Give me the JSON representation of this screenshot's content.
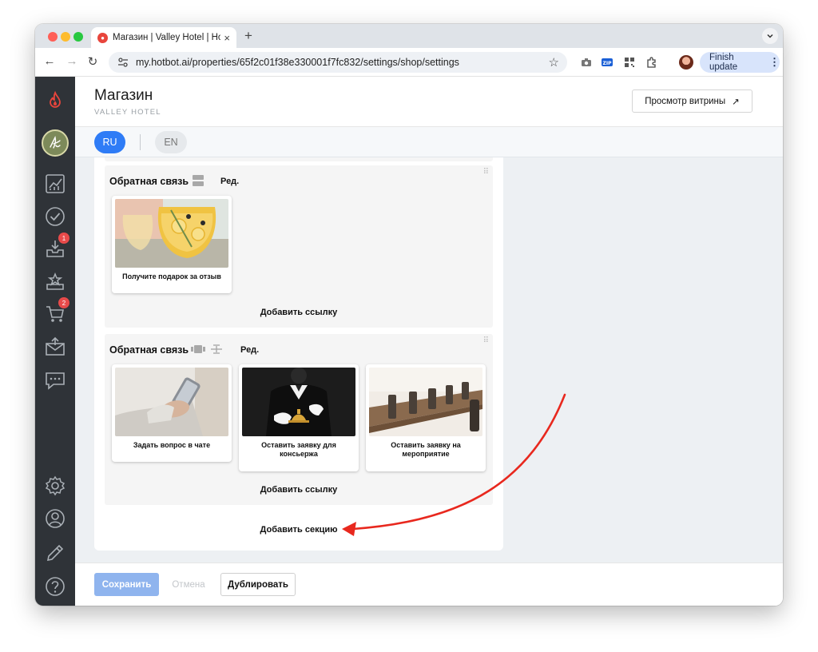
{
  "browser": {
    "tab_title": "Магазин | Valley Hotel | Hotbot",
    "new_tab": "+",
    "tab_close": "×",
    "url": "my.hotbot.ai/properties/65f2c01f38e330001f7fc832/settings/shop/settings",
    "finish_update": "Finish update",
    "zip_label": "ZIP"
  },
  "sidebar": {
    "badges": {
      "inbox": "1",
      "cart": "2"
    }
  },
  "header": {
    "title": "Магазин",
    "subtitle": "VALLEY HOTEL",
    "preview_button": "Просмотр витрины",
    "preview_arrow": "↗"
  },
  "languages": {
    "ru": "RU",
    "en": "EN"
  },
  "sections": [
    {
      "title": "Обратная связь",
      "edit": "Ред.",
      "add_link": "Добавить ссылку",
      "cards": [
        {
          "label": "Получите подарок за отзыв"
        }
      ]
    },
    {
      "title": "Обратная связь",
      "edit": "Ред.",
      "add_link": "Добавить ссылку",
      "cards": [
        {
          "label": "Задать вопрос в чате"
        },
        {
          "label": "Оставить заявку для консьержа"
        },
        {
          "label": "Оставить заявку на мероприятие"
        }
      ]
    }
  ],
  "add_section": "Добавить секцию",
  "footer": {
    "save": "Сохранить",
    "cancel": "Отмена",
    "duplicate": "Дублировать"
  },
  "colors": {
    "primary": "#2f7cf6",
    "sidebar": "#2f3338",
    "annotation_arrow": "#e8281e",
    "badge": "#e84a4a"
  }
}
